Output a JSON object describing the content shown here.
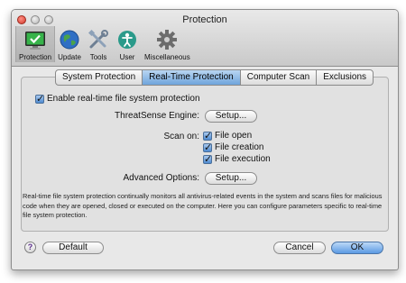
{
  "window": {
    "title": "Protection"
  },
  "toolbar": {
    "items": [
      {
        "label": "Protection",
        "icon": "monitor-check-icon",
        "selected": true
      },
      {
        "label": "Update",
        "icon": "globe-icon"
      },
      {
        "label": "Tools",
        "icon": "tools-icon"
      },
      {
        "label": "User",
        "icon": "user-icon"
      },
      {
        "label": "Miscellaneous",
        "icon": "gear-icon"
      }
    ]
  },
  "tabs": [
    {
      "label": "System Protection"
    },
    {
      "label": "Real-Time Protection",
      "active": true
    },
    {
      "label": "Computer Scan"
    },
    {
      "label": "Exclusions"
    }
  ],
  "content": {
    "enable_label": "Enable real-time file system protection",
    "enable_checked": true,
    "threatsense_label": "ThreatSense Engine:",
    "threatsense_button": "Setup...",
    "scan_on_label": "Scan on:",
    "scan_on_options": [
      {
        "label": "File open",
        "checked": true
      },
      {
        "label": "File creation",
        "checked": true
      },
      {
        "label": "File execution",
        "checked": true
      }
    ],
    "advanced_label": "Advanced Options:",
    "advanced_button": "Setup...",
    "description": "Real-time file system protection continually monitors all antivirus-related events in the system and scans files for malicious code when they are opened, closed or executed on the computer. Here you can configure parameters specific to real-time file system protection."
  },
  "footer": {
    "help_label": "?",
    "default_button": "Default",
    "cancel_button": "Cancel",
    "ok_button": "OK"
  },
  "colors": {
    "accent": "#5b9ae3",
    "window_bg": "#e8e8e8"
  }
}
